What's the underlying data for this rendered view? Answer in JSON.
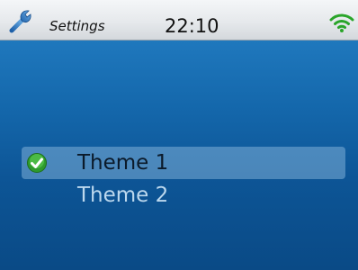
{
  "status_bar": {
    "app_icon": "wrench-icon",
    "app_title": "Settings",
    "time": "22:10",
    "signal_icon": "wifi-icon"
  },
  "theme_list": {
    "items": [
      {
        "label": "Theme 1",
        "selected": true,
        "indicator_icon": "check-icon"
      },
      {
        "label": "Theme 2",
        "selected": false
      }
    ]
  },
  "colors": {
    "background_top": "#1f78bd",
    "background_bottom": "#0a4a86",
    "selection_highlight": "#7dafd7",
    "check_green": "#3cb83a",
    "wifi_green": "#2aa52a"
  }
}
